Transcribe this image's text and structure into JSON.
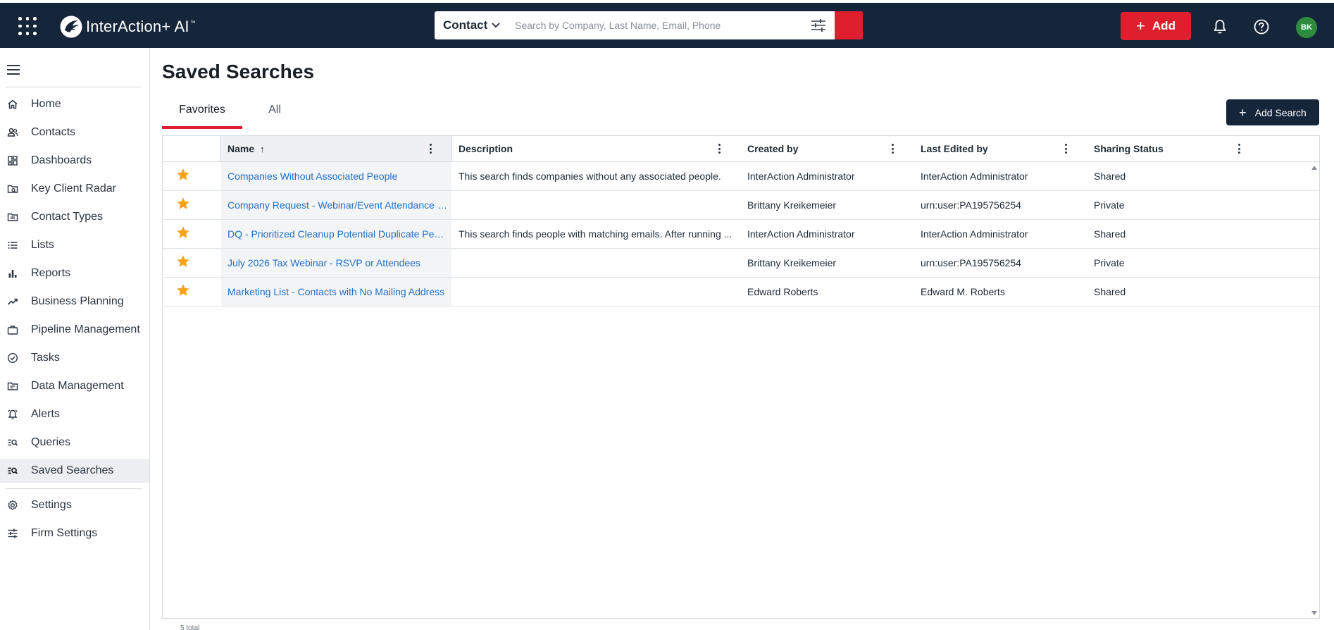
{
  "app": {
    "logo_text": "InterAction+ AI",
    "logo_tm": "™"
  },
  "search": {
    "type_label": "Contact",
    "placeholder": "Search by Company, Last Name, Email, Phone"
  },
  "header": {
    "add_label": "Add",
    "avatar_initials": "BK",
    "avatar_color": "#2e8b3e",
    "accent_color": "#df1f2d",
    "bar_color": "#15253a"
  },
  "sidebar": {
    "items": [
      {
        "label": "Home",
        "icon": "home-icon"
      },
      {
        "label": "Contacts",
        "icon": "contacts-icon"
      },
      {
        "label": "Dashboards",
        "icon": "dashboard-icon"
      },
      {
        "label": "Key Client Radar",
        "icon": "radar-folder-icon"
      },
      {
        "label": "Contact Types",
        "icon": "contact-types-folder-icon"
      },
      {
        "label": "Lists",
        "icon": "list-icon"
      },
      {
        "label": "Reports",
        "icon": "bar-chart-icon"
      },
      {
        "label": "Business Planning",
        "icon": "trend-icon"
      },
      {
        "label": "Pipeline Management",
        "icon": "briefcase-icon"
      },
      {
        "label": "Tasks",
        "icon": "check-circle-icon"
      },
      {
        "label": "Data Management",
        "icon": "data-folder-icon"
      },
      {
        "label": "Alerts",
        "icon": "alarm-bell-icon"
      },
      {
        "label": "Queries",
        "icon": "query-icon"
      },
      {
        "label": "Saved Searches",
        "icon": "saved-search-icon",
        "active": true
      }
    ],
    "bottom_items": [
      {
        "label": "Settings",
        "icon": "gear-icon"
      },
      {
        "label": "Firm Settings",
        "icon": "sliders-icon"
      }
    ]
  },
  "main": {
    "title": "Saved Searches",
    "tabs": [
      {
        "label": "Favorites",
        "active": true
      },
      {
        "label": "All",
        "active": false
      }
    ],
    "add_search_label": "Add Search",
    "columns": [
      "Name",
      "Description",
      "Created by",
      "Last Edited by",
      "Sharing Status"
    ],
    "sort": {
      "column": "Name",
      "direction": "ascending",
      "glyph": "↑"
    },
    "rows": [
      {
        "favorite": true,
        "name": "Companies Without Associated People",
        "description": "This search finds companies without any associated people.",
        "created_by": "InterAction Administrator",
        "last_edited_by": "InterAction Administrator",
        "sharing": "Shared"
      },
      {
        "favorite": true,
        "name": "Company Request - Webinar/Event Attendance S...",
        "description": "",
        "created_by": "Brittany Kreikemeier",
        "last_edited_by": "urn:user:PA195756254",
        "sharing": "Private"
      },
      {
        "favorite": true,
        "name": "DQ - Prioritized Cleanup Potential Duplicate Peo...",
        "description": "This search finds people with matching emails. After running ...",
        "created_by": "InterAction Administrator",
        "last_edited_by": "InterAction Administrator",
        "sharing": "Shared"
      },
      {
        "favorite": true,
        "name": "July 2026 Tax Webinar - RSVP or Attendees",
        "description": "",
        "created_by": "Brittany Kreikemeier",
        "last_edited_by": "urn:user:PA195756254",
        "sharing": "Private"
      },
      {
        "favorite": true,
        "name": "Marketing List - Contacts with No Mailing Address",
        "description": "",
        "created_by": "Edward Roberts",
        "last_edited_by": "Edward M. Roberts",
        "sharing": "Shared"
      }
    ],
    "footer_text": "5 total"
  }
}
